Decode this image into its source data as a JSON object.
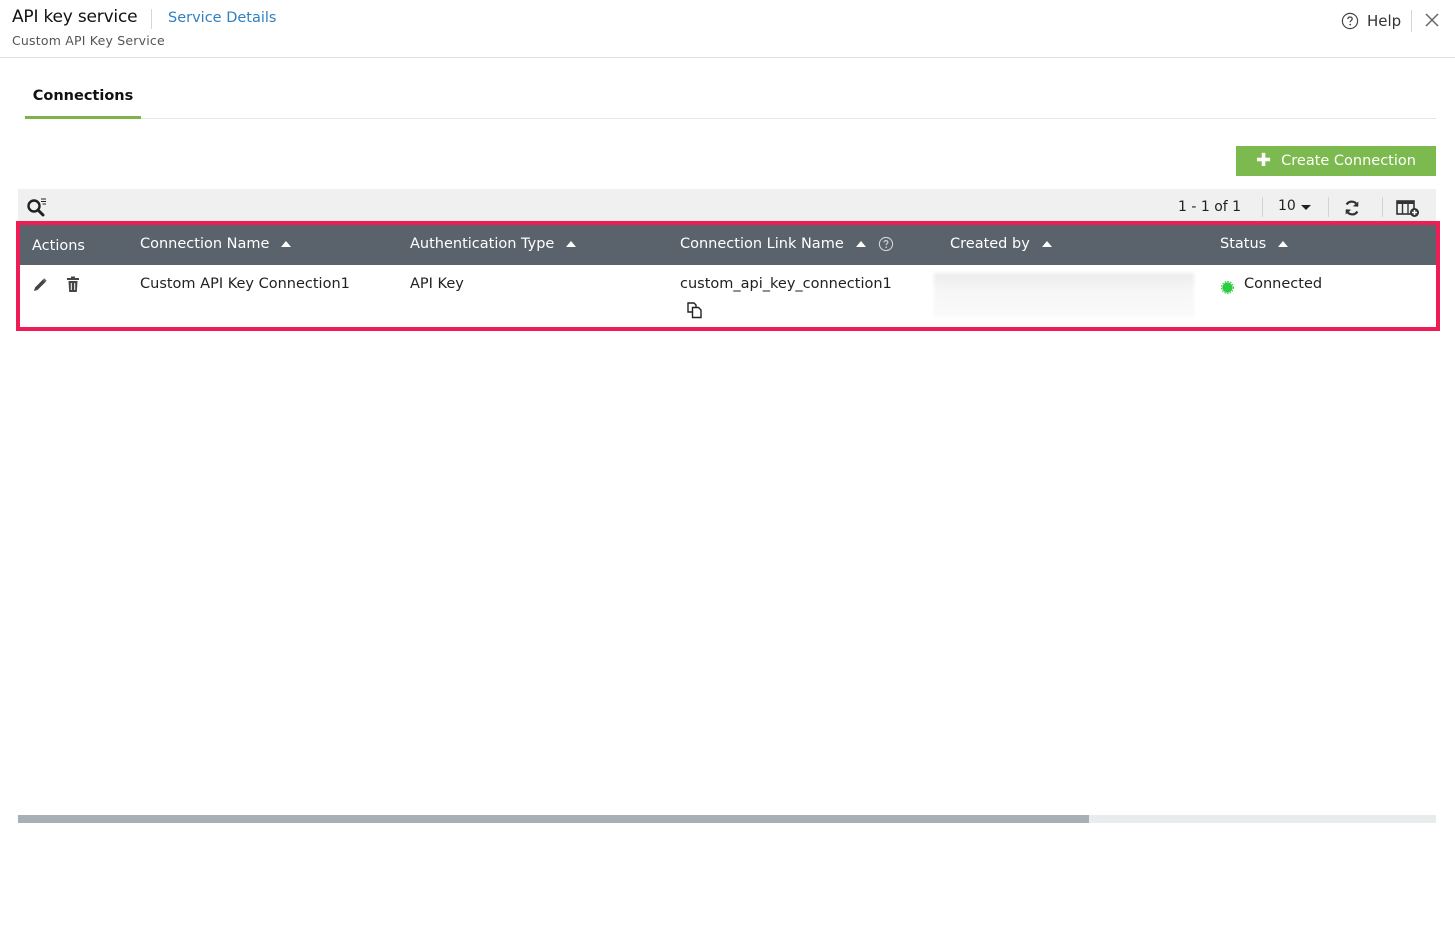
{
  "header": {
    "app_title": "API key service",
    "service_link": "Service Details",
    "subtitle": "Custom API Key Service",
    "help_label": "Help",
    "help_icon": "question-circle-icon",
    "close_icon": "close-icon"
  },
  "tabs": [
    {
      "label": "Connections",
      "active": true
    }
  ],
  "create_button": {
    "label": "Create Connection",
    "icon": "plus-icon",
    "color": "#7cba4f"
  },
  "toolbar": {
    "pagination": "1 - 1 of 1",
    "per_page": "10",
    "icons": [
      "search-filter-icon",
      "refresh-icon",
      "column-settings-icon"
    ]
  },
  "table": {
    "columns": [
      {
        "label": "Actions",
        "sortable": false
      },
      {
        "label": "Connection Name",
        "sortable": true
      },
      {
        "label": "Authentication Type",
        "sortable": true
      },
      {
        "label": "Connection Link Name",
        "sortable": true,
        "help": true
      },
      {
        "label": "Created by",
        "sortable": true
      },
      {
        "label": "Status",
        "sortable": true
      }
    ],
    "rows": [
      {
        "actions": [
          "edit-icon",
          "delete-icon"
        ],
        "connection_name": "Custom API Key Connection1",
        "auth_type": "API Key",
        "link_name": "custom_api_key_connection1",
        "created_by": "",
        "status": "Connected",
        "status_color": "#2ecc40"
      }
    ]
  },
  "colors": {
    "accent_green": "#7cba4f",
    "link_blue": "#2f7fc1",
    "header_gray": "#5a626b",
    "highlight": "#ee1d55"
  }
}
